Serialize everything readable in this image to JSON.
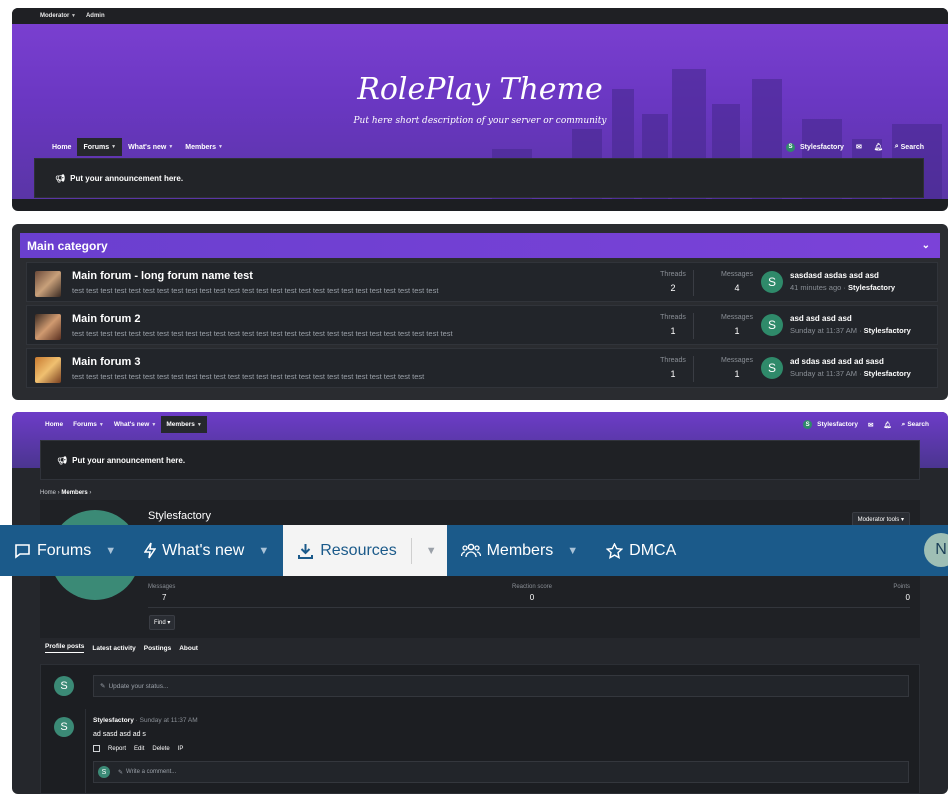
{
  "shot1": {
    "topbar": {
      "moderator": "Moderator",
      "admin": "Admin"
    },
    "hero": {
      "title": "RolePlay Theme",
      "description": "Put here short description of your server or community"
    },
    "nav": {
      "home": "Home",
      "forums": "Forums",
      "whats_new": "What's new",
      "members": "Members",
      "user": "Stylesfactory",
      "user_initial": "S",
      "search": "Search"
    },
    "announcement": "Put your announcement here."
  },
  "shot2": {
    "category_title": "Main category",
    "forums": [
      {
        "title": "Main forum - long forum name test",
        "description": "test test test test test test test test test test test test test test test test test test test test test test test test test test",
        "threads_label": "Threads",
        "threads": "2",
        "messages_label": "Messages",
        "messages": "4",
        "last_initial": "S",
        "last_title": "sasdasd asdas asd asd",
        "last_time": "41 minutes ago",
        "last_user": "Stylesfactory"
      },
      {
        "title": "Main forum 2",
        "description": "test test test test test test test test test test test test test test test test test test test test test test test test test test test",
        "threads_label": "Threads",
        "threads": "1",
        "messages_label": "Messages",
        "messages": "1",
        "last_initial": "S",
        "last_title": "asd asd asd asd",
        "last_time": "Sunday at 11:37 AM",
        "last_user": "Stylesfactory"
      },
      {
        "title": "Main forum 3",
        "description": "test test test test test test test test test test test test test test test test test test test test test test test test test",
        "threads_label": "Threads",
        "threads": "1",
        "messages_label": "Messages",
        "messages": "1",
        "last_initial": "S",
        "last_title": "ad sdas asd asd ad sasd",
        "last_time": "Sunday at 11:37 AM",
        "last_user": "Stylesfactory"
      }
    ]
  },
  "shot3": {
    "nav": {
      "home": "Home",
      "forums": "Forums",
      "whats_new": "What's new",
      "members": "Members",
      "user": "Stylesfactory",
      "user_initial": "S",
      "search": "Search"
    },
    "announcement": "Put your announcement here.",
    "breadcrumb": {
      "home": "Home",
      "members": "Members"
    },
    "profile": {
      "name": "Stylesfactory",
      "moderator_tools": "Moderator tools",
      "messages_label": "Messages",
      "messages": "7",
      "reaction_label": "Reaction score",
      "reaction": "0",
      "points_label": "Points",
      "points": "0",
      "find": "Find"
    },
    "tabs": [
      "Profile posts",
      "Latest activity",
      "Postings",
      "About"
    ],
    "status_placeholder": "Update your status...",
    "post": {
      "author": "Stylesfactory",
      "time": "Sunday at 11:37 AM",
      "text": "ad sasd asd ad s",
      "actions": [
        "Report",
        "Edit",
        "Delete",
        "IP"
      ],
      "comment_placeholder": "Write a comment..."
    },
    "avatar_initial": "S"
  },
  "bluebar": {
    "forums": "Forums",
    "whats_new": "What's new",
    "resources": "Resources",
    "members": "Members",
    "dmca": "DMCA",
    "avatar_initial": "N",
    "colors": {
      "bar": "#1b5a8a",
      "active_bg": "#f4f4f4"
    }
  }
}
